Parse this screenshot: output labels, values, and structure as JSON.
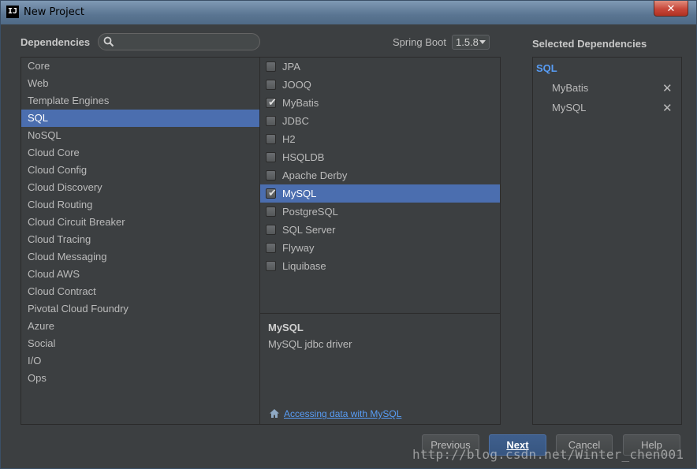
{
  "window": {
    "title": "New Project",
    "close_glyph": "✕"
  },
  "header": {
    "dependencies_label": "Dependencies",
    "search": {
      "value": "",
      "placeholder": ""
    },
    "spring_boot_label": "Spring Boot",
    "spring_boot_version": "1.5.8",
    "selected_dependencies_label": "Selected Dependencies"
  },
  "categories": [
    {
      "label": "Core",
      "selected": false
    },
    {
      "label": "Web",
      "selected": false
    },
    {
      "label": "Template Engines",
      "selected": false
    },
    {
      "label": "SQL",
      "selected": true
    },
    {
      "label": "NoSQL",
      "selected": false
    },
    {
      "label": "Cloud Core",
      "selected": false
    },
    {
      "label": "Cloud Config",
      "selected": false
    },
    {
      "label": "Cloud Discovery",
      "selected": false
    },
    {
      "label": "Cloud Routing",
      "selected": false
    },
    {
      "label": "Cloud Circuit Breaker",
      "selected": false
    },
    {
      "label": "Cloud Tracing",
      "selected": false
    },
    {
      "label": "Cloud Messaging",
      "selected": false
    },
    {
      "label": "Cloud AWS",
      "selected": false
    },
    {
      "label": "Cloud Contract",
      "selected": false
    },
    {
      "label": "Pivotal Cloud Foundry",
      "selected": false
    },
    {
      "label": "Azure",
      "selected": false
    },
    {
      "label": "Social",
      "selected": false
    },
    {
      "label": "I/O",
      "selected": false
    },
    {
      "label": "Ops",
      "selected": false
    }
  ],
  "dependencies": [
    {
      "label": "JPA",
      "checked": false,
      "selected": false
    },
    {
      "label": "JOOQ",
      "checked": false,
      "selected": false
    },
    {
      "label": "MyBatis",
      "checked": true,
      "selected": false
    },
    {
      "label": "JDBC",
      "checked": false,
      "selected": false
    },
    {
      "label": "H2",
      "checked": false,
      "selected": false
    },
    {
      "label": "HSQLDB",
      "checked": false,
      "selected": false
    },
    {
      "label": "Apache Derby",
      "checked": false,
      "selected": false
    },
    {
      "label": "MySQL",
      "checked": true,
      "selected": true
    },
    {
      "label": "PostgreSQL",
      "checked": false,
      "selected": false
    },
    {
      "label": "SQL Server",
      "checked": false,
      "selected": false
    },
    {
      "label": "Flyway",
      "checked": false,
      "selected": false
    },
    {
      "label": "Liquibase",
      "checked": false,
      "selected": false
    }
  ],
  "detail": {
    "title": "MySQL",
    "description": "MySQL jdbc driver",
    "link_text": "Accessing data with MySQL",
    "link_icon": "home-icon"
  },
  "selected": {
    "group": "SQL",
    "items": [
      {
        "label": "MyBatis",
        "remove_glyph": "✕"
      },
      {
        "label": "MySQL",
        "remove_glyph": "✕"
      }
    ]
  },
  "buttons": {
    "previous": "Previous",
    "next": "Next",
    "cancel": "Cancel",
    "help": "Help"
  },
  "watermark": "http://blog.csdn.net/Winter_chen001",
  "colors": {
    "background": "#3c3f41",
    "selection": "#4b6eaf",
    "link": "#589df6"
  }
}
